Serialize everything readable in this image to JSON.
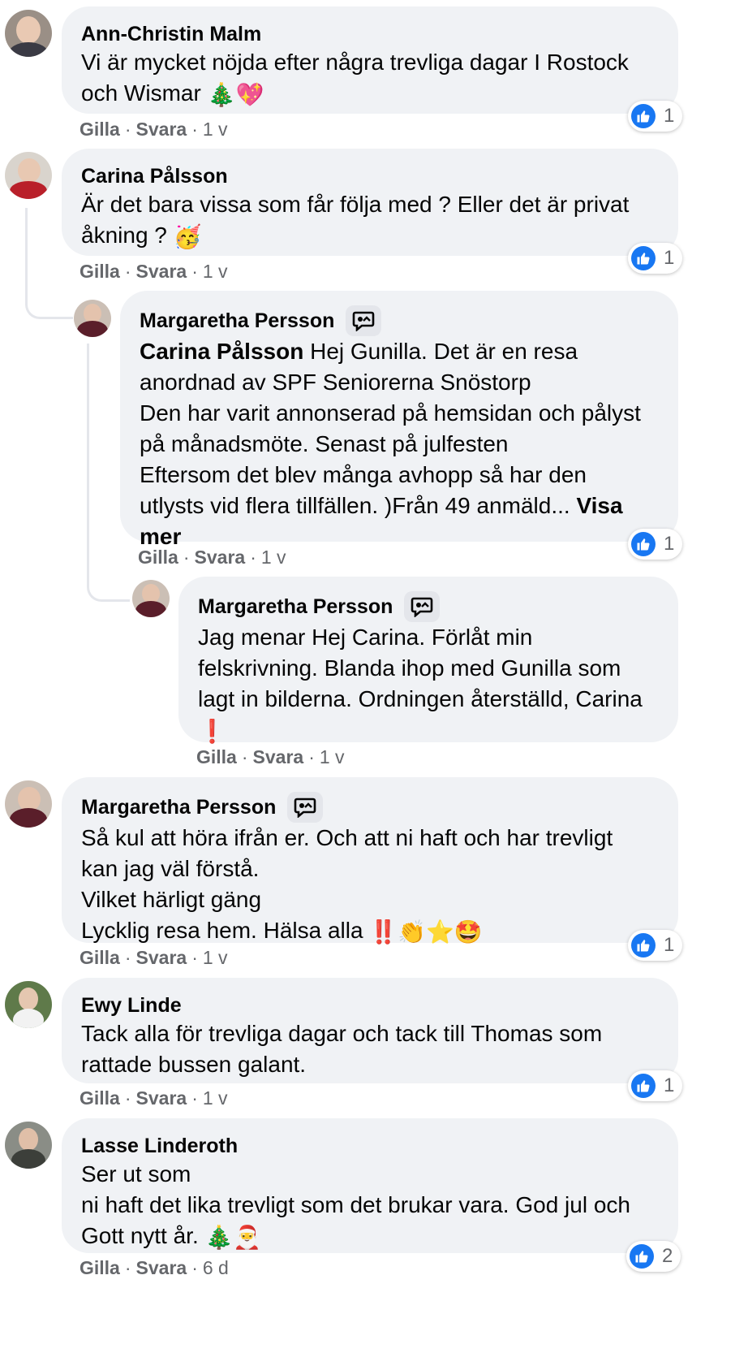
{
  "actions": {
    "like": "Gilla",
    "reply": "Svara"
  },
  "comments": [
    {
      "name": "Ann-Christin Malm",
      "text": "Vi är mycket nöjda efter några trevliga dagar I Rostock\noch Wismar ",
      "emoji": "🎄💖",
      "time": "1 v",
      "reactions": "1"
    },
    {
      "name": "Carina Pålsson",
      "text": "Är det bara vissa som får följa med ? Eller det är privat\nåkning ? ",
      "emoji": "🥳",
      "time": "1 v",
      "reactions": "1"
    },
    {
      "name": "Margaretha Persson",
      "mention": "Carina Pålsson",
      "text": " Hej Gunilla. Det är en resa\nanordnad av SPF Seniorerna Snöstorp\nDen har varit annonserad på hemsidan och pålyst\npå månadsmöte. Senast på julfesten\nEftersom det blev många avhopp så har den\nutlysts vid flera tillfällen. )Från 49 anmäld... ",
      "more": "Visa\nmer",
      "time": "1 v",
      "reactions": "1"
    },
    {
      "name": "Margaretha Persson",
      "text": "Jag menar Hej Carina. Förlåt min\nfelskrivning. Blanda ihop med Gunilla som\nlagt in bilderna. Ordningen återställd, Carina\n",
      "emoji": "❗",
      "time": "1 v"
    },
    {
      "name": "Margaretha Persson",
      "text": "Så kul att höra ifrån er. Och att ni haft och har trevligt\nkan jag väl förstå.\nVilket härligt gäng\nLycklig resa hem. Hälsa alla ",
      "emoji": "‼️👏⭐🤩",
      "time": "1 v",
      "reactions": "1"
    },
    {
      "name": "Ewy Linde",
      "text": "Tack alla för trevliga dagar och tack till Thomas som\nrattade bussen galant.",
      "time": "1 v",
      "reactions": "1"
    },
    {
      "name": "Lasse Linderoth",
      "text": "Ser ut som\nni haft det lika trevligt som det brukar vara. God jul och\nGott nytt år. ",
      "emoji": "🎄🎅",
      "time": "6 d",
      "reactions": "2"
    }
  ],
  "colors": {
    "like_blue": "#1877f2",
    "bubble": "#f0f2f5",
    "meta": "#65676b"
  }
}
